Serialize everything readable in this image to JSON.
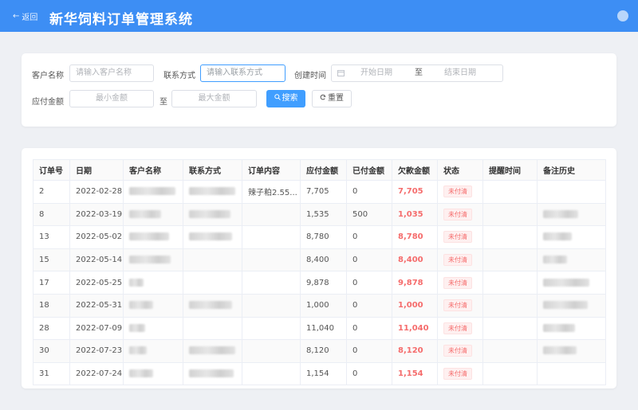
{
  "header": {
    "back_label": "返回",
    "title": "新华饲料订单管理系统"
  },
  "filters": {
    "customer_label": "客户名称",
    "customer_placeholder": "请输入客户名称",
    "contact_label": "联系方式",
    "contact_placeholder": "请输入联系方式",
    "created_label": "创建时间",
    "start_placeholder": "开始日期",
    "range_sep": "至",
    "end_placeholder": "结束日期",
    "amount_label": "应付金额",
    "min_placeholder": "最小金额",
    "amount_sep": "至",
    "max_placeholder": "最大金额",
    "search_label": "搜索",
    "reset_label": "重置"
  },
  "table": {
    "columns": [
      "订单号",
      "日期",
      "客户名称",
      "联系方式",
      "订单内容",
      "应付金额",
      "已付金额",
      "欠款金额",
      "状态",
      "提醒时间",
      "备注历史"
    ],
    "rows": [
      {
        "id": "2",
        "date": "2022-02-28",
        "content": "辣子粕2.55...",
        "payable": "7,705",
        "paid": "0",
        "owed": "7,705",
        "status": "未付清"
      },
      {
        "id": "8",
        "date": "2022-03-19",
        "content": "",
        "payable": "1,535",
        "paid": "500",
        "owed": "1,035",
        "status": "未付清"
      },
      {
        "id": "13",
        "date": "2022-05-02",
        "content": "",
        "payable": "8,780",
        "paid": "0",
        "owed": "8,780",
        "status": "未付清"
      },
      {
        "id": "15",
        "date": "2022-05-14",
        "content": "",
        "payable": "8,400",
        "paid": "0",
        "owed": "8,400",
        "status": "未付清"
      },
      {
        "id": "17",
        "date": "2022-05-25",
        "content": "",
        "payable": "9,878",
        "paid": "0",
        "owed": "9,878",
        "status": "未付清"
      },
      {
        "id": "18",
        "date": "2022-05-31",
        "content": "",
        "payable": "1,000",
        "paid": "0",
        "owed": "1,000",
        "status": "未付清"
      },
      {
        "id": "28",
        "date": "2022-07-09",
        "content": "",
        "payable": "11,040",
        "paid": "0",
        "owed": "11,040",
        "status": "未付清"
      },
      {
        "id": "30",
        "date": "2022-07-23",
        "content": "",
        "payable": "8,120",
        "paid": "0",
        "owed": "8,120",
        "status": "未付清"
      },
      {
        "id": "31",
        "date": "2022-07-24",
        "content": "",
        "payable": "1,154",
        "paid": "0",
        "owed": "1,154",
        "status": "未付清"
      }
    ]
  },
  "colors": {
    "header_bg": "#3d8ef4",
    "primary": "#409eff",
    "owed_text": "#f56c6c"
  }
}
